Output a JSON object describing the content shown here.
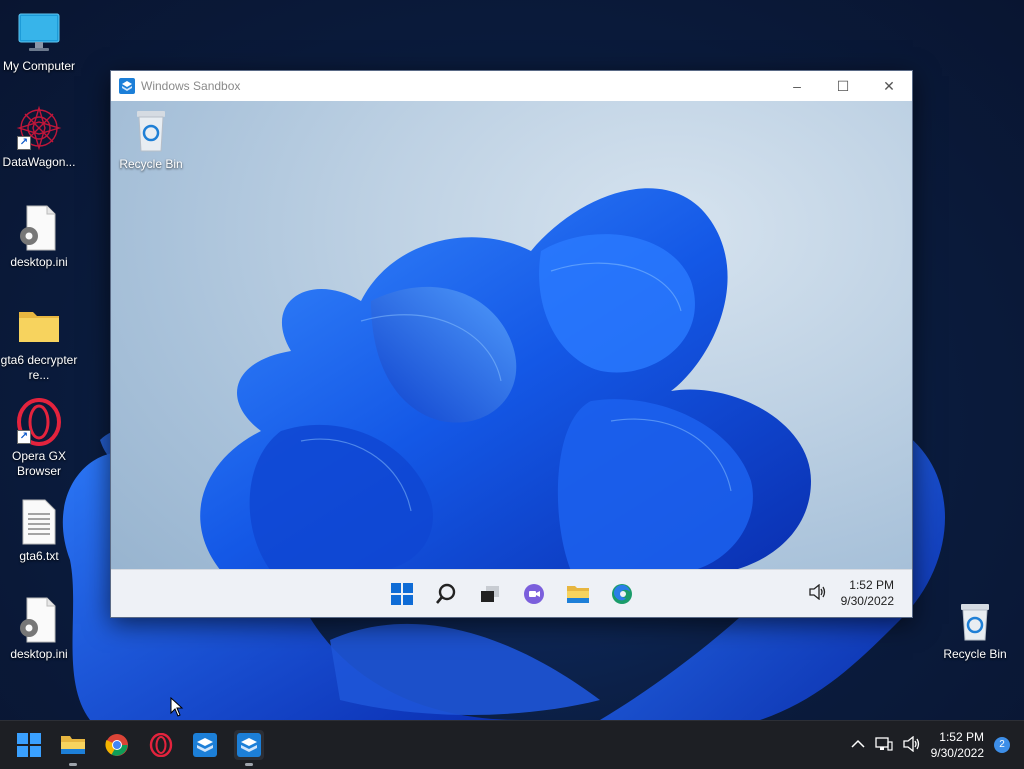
{
  "desktop": {
    "icons": [
      {
        "label": "My Computer",
        "icon": "monitor-icon"
      },
      {
        "label": "DataWagon...",
        "icon": "fractal-app-icon",
        "shortcut": true
      },
      {
        "label": "desktop.ini",
        "icon": "settings-file-icon"
      },
      {
        "label": "gta6 decrypter re...",
        "icon": "folder-icon"
      },
      {
        "label": "Opera GX Browser",
        "icon": "opera-gx-icon",
        "shortcut": true
      },
      {
        "label": "gta6.txt",
        "icon": "text-file-icon"
      },
      {
        "label": "desktop.ini",
        "icon": "settings-file-icon"
      }
    ],
    "recycle_bin": {
      "label": "Recycle Bin",
      "icon": "recycle-bin-icon"
    }
  },
  "sandbox_window": {
    "title": "Windows Sandbox",
    "controls": {
      "minimize": "–",
      "maximize": "☐",
      "close": "✕"
    },
    "desktop_icon": {
      "label": "Recycle Bin",
      "icon": "recycle-bin-icon"
    },
    "taskbar": {
      "apps": [
        "start-icon",
        "search-icon",
        "task-view-icon",
        "chat-icon",
        "file-explorer-icon",
        "edge-icon"
      ],
      "clock": {
        "time": "1:52 PM",
        "date": "9/30/2022"
      }
    }
  },
  "taskbar": {
    "apps": [
      "start-icon",
      "file-explorer-icon",
      "chrome-icon",
      "opera-gx-icon",
      "sandbox-icon",
      "sandbox-icon"
    ],
    "clock": {
      "time": "1:52 PM",
      "date": "9/30/2022"
    },
    "notification_count": "2"
  },
  "colors": {
    "accent": "#0067c0",
    "bloom": "#1a5ef0",
    "taskbar_dark": "#1d1f24"
  }
}
